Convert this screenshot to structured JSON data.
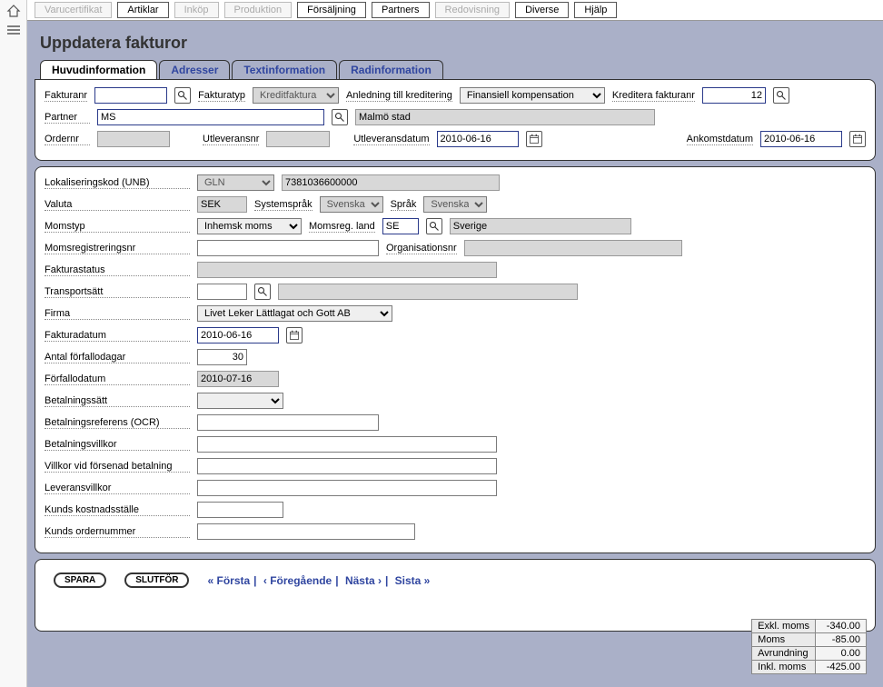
{
  "topnav": {
    "items": [
      "Varucertifikat",
      "Artiklar",
      "Inköp",
      "Produktion",
      "Försäljning",
      "Partners",
      "Redovisning",
      "Diverse",
      "Hjälp"
    ],
    "enabled": [
      false,
      true,
      false,
      false,
      true,
      true,
      false,
      true,
      true
    ]
  },
  "page_title": "Uppdatera fakturor",
  "subtabs": [
    "Huvudinformation",
    "Adresser",
    "Textinformation",
    "Radinformation"
  ],
  "header": {
    "fakturanr_label": "Fakturanr",
    "fakturanr": "",
    "fakturatyp_label": "Fakturatyp",
    "fakturatyp": "Kreditfaktura",
    "anledning_label": "Anledning till kreditering",
    "anledning": "Finansiell kompensation",
    "kreditera_label": "Kreditera fakturanr",
    "kreditera_nr": "12",
    "partner_label": "Partner",
    "partner_code": "MS",
    "partner_name": "Malmö stad",
    "ordernr_label": "Ordernr",
    "ordernr": "",
    "utleveransnr_label": "Utleveransnr",
    "utleveransnr": "",
    "utleveransdatum_label": "Utleveransdatum",
    "utleveransdatum": "2010-06-16",
    "ankomstdatum_label": "Ankomstdatum",
    "ankomstdatum": "2010-06-16"
  },
  "body": {
    "lokaliseringskod_label": "Lokaliseringskod (UNB)",
    "lokaliseringskod_type": "GLN",
    "lokaliseringskod": "7381036600000",
    "valuta_label": "Valuta",
    "valuta": "SEK",
    "systemsprak_label": "Systemspråk",
    "systemsprak": "Svenska",
    "sprak_label": "Språk",
    "sprak": "Svenska",
    "momstyp_label": "Momstyp",
    "momstyp": "Inhemsk moms",
    "momsregland_label": "Momsreg. land",
    "momsregland_code": "SE",
    "momsregland_name": "Sverige",
    "momsregistreringsnr_label": "Momsregistreringsnr",
    "momsregistreringsnr": "",
    "organisationsnr_label": "Organisationsnr",
    "organisationsnr": "",
    "fakturastatus_label": "Fakturastatus",
    "fakturastatus": "",
    "transportsatt_label": "Transportsätt",
    "transportsatt_code": "",
    "transportsatt_name": "",
    "firma_label": "Firma",
    "firma": "Livet Leker Lättlagat och Gott AB",
    "fakturadatum_label": "Fakturadatum",
    "fakturadatum": "2010-06-16",
    "antal_forfallodagar_label": "Antal förfallodagar",
    "antal_forfallodagar": "30",
    "forfallodatum_label": "Förfallodatum",
    "forfallodatum": "2010-07-16",
    "betalningssatt_label": "Betalningssätt",
    "betalningssatt": "",
    "betalningsreferens_label": "Betalningsreferens (OCR)",
    "betalningsreferens": "",
    "betalningsvillkor_label": "Betalningsvillkor",
    "betalningsvillkor": "",
    "villkor_forsenad_label": "Villkor vid försenad betalning",
    "villkor_forsenad": "",
    "leveransvillkor_label": "Leveransvillkor",
    "leveransvillkor": "",
    "kunds_kostnadsställe_label": "Kunds kostnadsställe",
    "kunds_kostnadsställe": "",
    "kunds_ordernummer_label": "Kunds ordernummer",
    "kunds_ordernummer": ""
  },
  "footer": {
    "spara": "SPARA",
    "slutfor": "SLUTFÖR",
    "nav": {
      "first": "« Första",
      "prev": "‹ Föregående",
      "next": "Nästa ›",
      "last": "Sista »"
    }
  },
  "totals": {
    "exkl_label": "Exkl. moms",
    "exkl": "-340.00",
    "moms_label": "Moms",
    "moms": "-85.00",
    "avrundning_label": "Avrundning",
    "avrundning": "0.00",
    "inkl_label": "Inkl. moms",
    "inkl": "-425.00"
  }
}
